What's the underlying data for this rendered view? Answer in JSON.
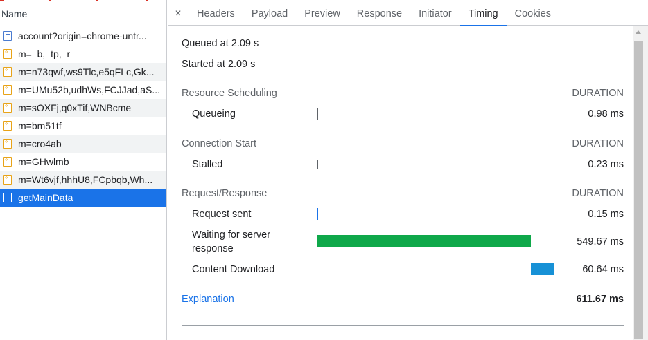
{
  "list": {
    "header": "Name",
    "rows": [
      {
        "name": "account?origin=chrome-untr...",
        "icon": "document-icon"
      },
      {
        "name": "m=_b,_tp,_r",
        "icon": "script-icon"
      },
      {
        "name": "m=n73qwf,ws9Tlc,e5qFLc,Gk...",
        "icon": "script-icon"
      },
      {
        "name": "m=UMu52b,udhWs,FCJJad,aS...",
        "icon": "script-icon"
      },
      {
        "name": "m=sOXFj,q0xTif,WNBcme",
        "icon": "script-icon"
      },
      {
        "name": "m=bm51tf",
        "icon": "script-icon"
      },
      {
        "name": "m=cro4ab",
        "icon": "script-icon"
      },
      {
        "name": "m=GHwlmb",
        "icon": "script-icon"
      },
      {
        "name": "m=Wt6vjf,hhhU8,FCpbqb,Wh...",
        "icon": "script-icon"
      },
      {
        "name": "getMainData",
        "icon": "fetch-icon"
      }
    ]
  },
  "tabs": {
    "close": "×",
    "items": [
      "Headers",
      "Payload",
      "Preview",
      "Response",
      "Initiator",
      "Timing",
      "Cookies"
    ],
    "active": "Timing"
  },
  "timing": {
    "queued": "Queued at 2.09 s",
    "started": "Started at 2.09 s",
    "duration_label": "DURATION",
    "sections": [
      {
        "title": "Resource Scheduling",
        "rows": [
          {
            "label": "Queueing",
            "value": "0.98 ms"
          }
        ]
      },
      {
        "title": "Connection Start",
        "rows": [
          {
            "label": "Stalled",
            "value": "0.23 ms"
          }
        ]
      },
      {
        "title": "Request/Response",
        "rows": [
          {
            "label": "Request sent",
            "value": "0.15 ms"
          },
          {
            "label_line1": "Waiting for server",
            "label_line2": "response",
            "value": "549.67 ms"
          },
          {
            "label": "Content Download",
            "value": "60.64 ms"
          }
        ]
      }
    ],
    "explanation": "Explanation",
    "total": "611.67 ms"
  },
  "colors": {
    "waiting_bar": "#0fa84a",
    "download_bar": "#1791d6",
    "accent": "#1a73e8"
  }
}
